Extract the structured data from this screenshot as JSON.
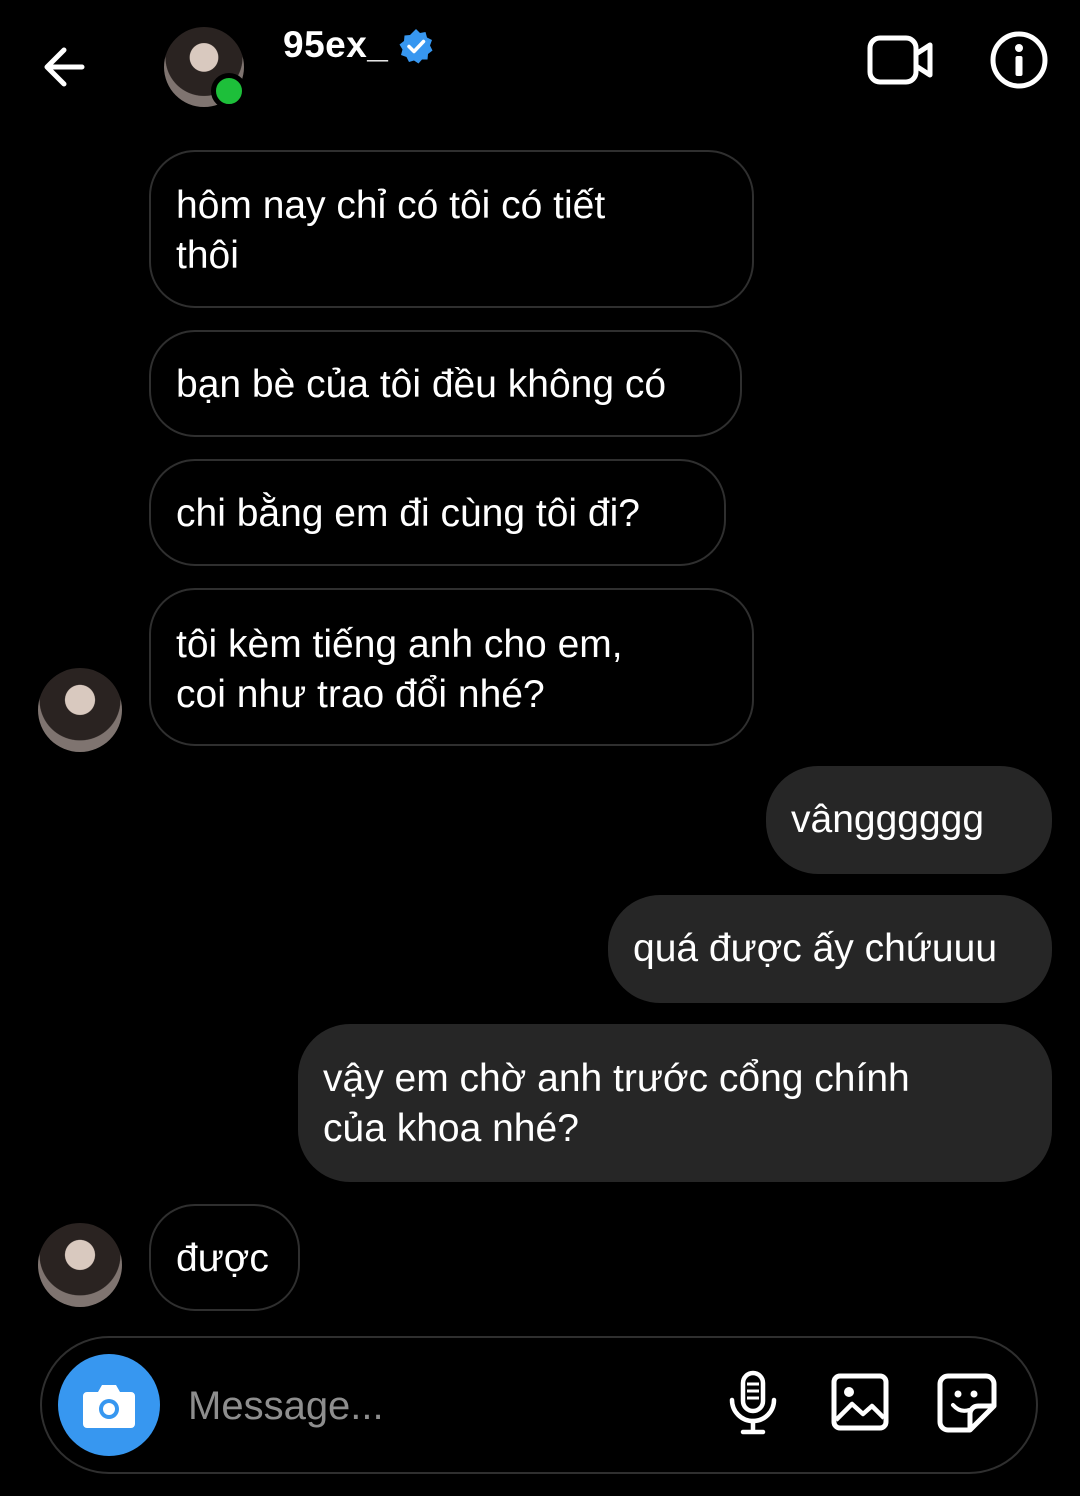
{
  "header": {
    "username": "95ex_",
    "icons": [
      "back-arrow-icon",
      "verified-badge-icon",
      "video-call-icon",
      "info-icon"
    ],
    "online_color": "#1dbf3a",
    "verified_color": "#3797f0"
  },
  "messages": [
    {
      "side": "incoming",
      "lines": [
        "hôm nay chỉ có tôi có tiết",
        "thôi"
      ]
    },
    {
      "side": "incoming",
      "lines": [
        "bạn bè của tôi đều không có"
      ]
    },
    {
      "side": "incoming",
      "lines": [
        "chi bằng em đi cùng tôi đi?"
      ]
    },
    {
      "side": "incoming",
      "lines": [
        "tôi kèm tiếng anh cho em,",
        "coi như trao đổi nhé?"
      ]
    },
    {
      "side": "outgoing",
      "lines": [
        "vângggggg"
      ]
    },
    {
      "side": "outgoing",
      "lines": [
        "quá được ấy chứuuu"
      ]
    },
    {
      "side": "outgoing",
      "lines": [
        "vậy em chờ anh trước cổng chính",
        "của khoa nhé?"
      ]
    },
    {
      "side": "incoming",
      "lines": [
        "được"
      ]
    }
  ],
  "composer": {
    "placeholder": "Message...",
    "icons": [
      "camera-icon",
      "microphone-icon",
      "gallery-icon",
      "sticker-icon"
    ],
    "camera_color": "#3797f0"
  },
  "theme": {
    "background": "#000000",
    "outgoing_bubble": "#262626",
    "incoming_border": "#2f2f2f"
  }
}
